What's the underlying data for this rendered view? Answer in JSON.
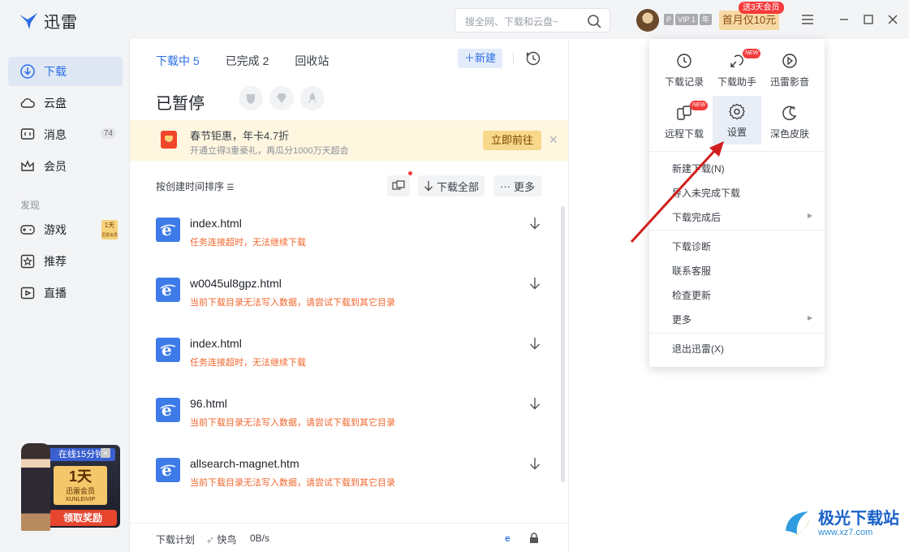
{
  "app": {
    "title": "迅雷"
  },
  "search": {
    "placeholder": "搜全网、下载和云盘~"
  },
  "account": {
    "vip_badges": [
      "P",
      "VIP 1",
      "年"
    ],
    "promo_label": "首月仅10元",
    "promo_tag": "送3天会员"
  },
  "sidebar": {
    "items": [
      {
        "label": "下载",
        "icon": "download-icon"
      },
      {
        "label": "云盘",
        "icon": "cloud-icon"
      },
      {
        "label": "消息",
        "icon": "message-icon",
        "count": "74"
      },
      {
        "label": "会员",
        "icon": "crown-icon"
      }
    ],
    "section": "发现",
    "discover": [
      {
        "label": "游戏",
        "icon": "gamepad-icon",
        "badge": [
          "1天",
          "迅雷会员"
        ]
      },
      {
        "label": "推荐",
        "icon": "star-icon"
      },
      {
        "label": "直播",
        "icon": "live-icon"
      }
    ],
    "promo": {
      "top": "在线15分钟",
      "day": "1天",
      "sub": "迅雷会员",
      "en": "XUNLEIVIP",
      "button": "领取奖励"
    }
  },
  "main": {
    "tabs": [
      {
        "label": "下载中 5"
      },
      {
        "label": "已完成 2"
      },
      {
        "label": "回收站"
      }
    ],
    "new_button": "＋新建",
    "section_title": "已暂停",
    "banner": {
      "title": "春节钜惠，年卡4.7折",
      "subtitle": "开通立得3重豪礼，再瓜分1000万天超会",
      "button": "立即前往"
    },
    "sort_label": "按创建时间排序",
    "download_all": "下载全部",
    "more": "更多",
    "rows": [
      {
        "name": "index.html",
        "error": "任务连接超时，无法继续下载"
      },
      {
        "name": "w0045ul8gpz.html",
        "error": "当前下载目录无法写入数据，请尝试下载到其它目录"
      },
      {
        "name": "index.html",
        "error": "任务连接超时，无法继续下载"
      },
      {
        "name": "96.html",
        "error": "当前下载目录无法写入数据，请尝试下载到其它目录"
      },
      {
        "name": "allsearch-magnet.htm",
        "error": "当前下载目录无法写入数据，请尝试下载到其它目录"
      }
    ],
    "footer": {
      "plan": "下载计划",
      "bird": "快鸟",
      "speed": "0B/s"
    }
  },
  "menu": {
    "grid": [
      {
        "label": "下载记录",
        "icon": "history-icon"
      },
      {
        "label": "下载助手",
        "icon": "assistant-icon",
        "tag": "NEW"
      },
      {
        "label": "迅雷影音",
        "icon": "player-icon"
      },
      {
        "label": "远程下载",
        "icon": "remote-download-icon",
        "tag": "NEW"
      },
      {
        "label": "设置",
        "icon": "gear-icon"
      },
      {
        "label": "深色皮肤",
        "icon": "moon-icon"
      }
    ],
    "items": [
      {
        "label": "新建下载(N)"
      },
      {
        "label": "导入未完成下载"
      },
      {
        "label": "下载完成后"
      },
      {
        "label": "下载诊断"
      },
      {
        "label": "联系客服"
      },
      {
        "label": "检查更新"
      },
      {
        "label": "更多"
      },
      {
        "label": "退出迅雷(X)"
      }
    ]
  },
  "watermark": {
    "title": "极光下载站",
    "url": "www.xz7.com"
  },
  "colors": {
    "accent": "#2b6de5",
    "error": "#f0662c",
    "arrow": "#d0201e"
  }
}
